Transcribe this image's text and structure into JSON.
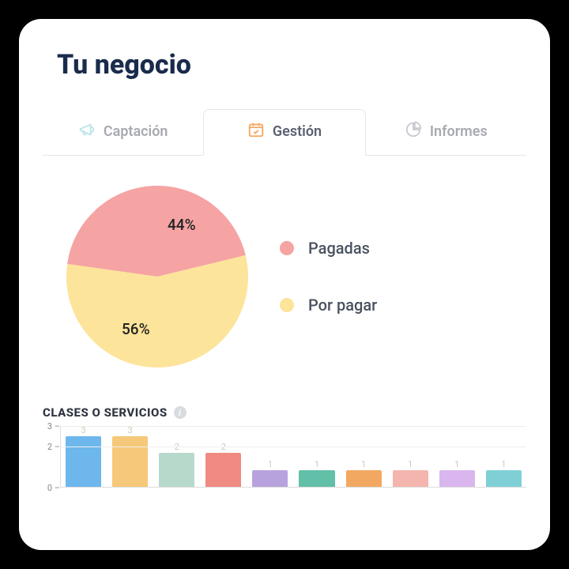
{
  "title": "Tu negocio",
  "tabs": {
    "captacion": "Captación",
    "gestion": "Gestión",
    "informes": "Informes",
    "active": "gestion"
  },
  "pie": {
    "legend_paid": "Pagadas",
    "legend_topay": "Por pagar",
    "label_paid": "44%",
    "label_topay": "56%"
  },
  "bar_section": {
    "title": "CLASES O SERVICIOS"
  },
  "chart_data": [
    {
      "type": "pie",
      "title": "",
      "series": [
        {
          "name": "Pagadas",
          "value": 44,
          "color": "#f5a3a3"
        },
        {
          "name": "Por pagar",
          "value": 56,
          "color": "#fde49b"
        }
      ]
    },
    {
      "type": "bar",
      "title": "CLASES O SERVICIOS",
      "ylim": [
        0,
        3
      ],
      "yticks": [
        0,
        2,
        3
      ],
      "categories": [
        "",
        "",
        "",
        "",
        "",
        "",
        "",
        "",
        "",
        ""
      ],
      "values": [
        3,
        3,
        2,
        2,
        1,
        1,
        1,
        1,
        1,
        1
      ],
      "colors": [
        "#6db7ec",
        "#f6c879",
        "#b7d9cc",
        "#f08a82",
        "#b7a2de",
        "#62bfa8",
        "#f3a861",
        "#f3b5ad",
        "#d9b6ee",
        "#7fd0d6"
      ]
    }
  ]
}
